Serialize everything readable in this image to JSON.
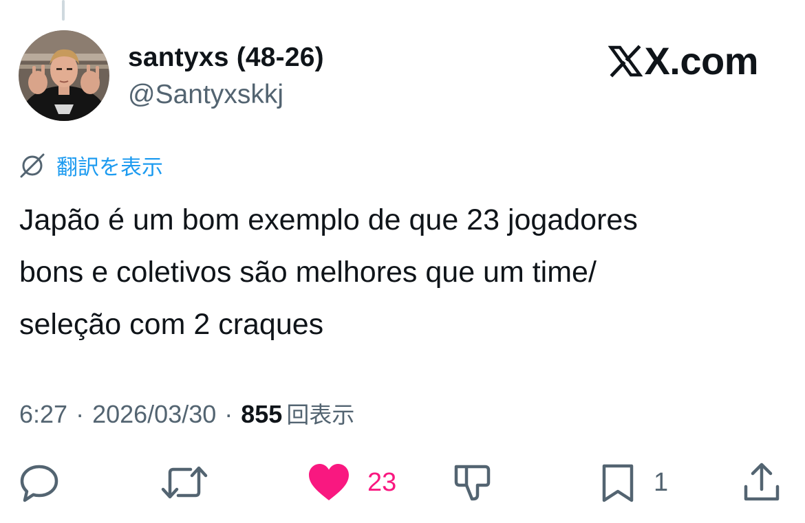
{
  "tweet": {
    "author": {
      "display_name": "santyxs (48-26)",
      "handle": "@Santyxskkj"
    },
    "brand": "X.com",
    "translate_label": "翻訳を表示",
    "text_lines": [
      "Japão é um bom exemplo de que 23 jogadores",
      "bons e coletivos são melhores que um time/",
      "seleção com 2 craques"
    ],
    "meta": {
      "time": "6:27",
      "separator": "·",
      "date": "2026/03/30",
      "views_count": "855",
      "views_label": "回表示"
    },
    "actions": {
      "reply_count": "",
      "retweet_count": "",
      "like_count": "23",
      "bookmark_count": "1"
    }
  },
  "icons": {
    "reply": "reply-icon",
    "retweet": "retweet-icon",
    "like": "heart-icon",
    "dislike": "thumbs-down-icon",
    "bookmark": "bookmark-icon",
    "share": "share-icon",
    "translate": "globe-slash-icon",
    "logo": "x-logo-icon"
  },
  "colors": {
    "text_primary": "#0f1419",
    "text_secondary": "#536471",
    "link_blue": "#1d9bf0",
    "like_pink": "#f91880",
    "thread_line": "#cfd9de"
  }
}
